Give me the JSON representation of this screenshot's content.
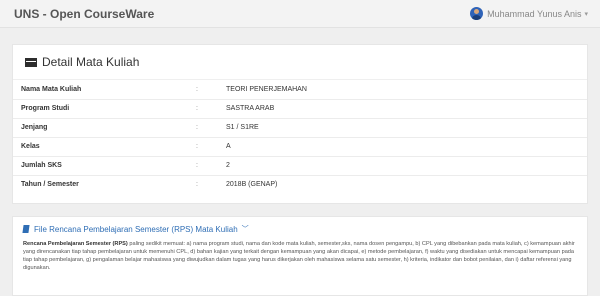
{
  "header": {
    "app_title": "UNS - Open CourseWare",
    "user_name": "Muhammad Yunus Anis"
  },
  "detail": {
    "title": "Detail Mata Kuliah",
    "separator": ":",
    "rows": [
      {
        "label": "Nama Mata Kuliah",
        "value": "TEORI PENERJEMAHAN"
      },
      {
        "label": "Program Studi",
        "value": "SASTRA ARAB"
      },
      {
        "label": "Jenjang",
        "value": "S1 / S1RE"
      },
      {
        "label": "Kelas",
        "value": "A"
      },
      {
        "label": "Jumlah SKS",
        "value": "2"
      },
      {
        "label": "Tahun / Semester",
        "value": "2018B (GENAP)"
      }
    ]
  },
  "rps": {
    "title": "File Rencana Pembelajaran Semester (RPS) Mata Kuliah",
    "bold_intro": "Rencana Pembelajaran Semester (RPS)",
    "description": "paling sedikit memuat: a) nama program studi, nama dan kode mata kuliah, semester,sks, nama dosen pengampu, b) CPL yang dibebankan pada mata kuliah, c) kemampuan akhir yang direncanakan tiap tahap pembelajaran untuk memenuhi CPL, d) bahan kajian yang terkait dengan kemampuan yang akan dicapai, e) metode pembelajaran, f) waktu yang disediakan untuk mencapai kemampuan pada tiap tahap pembelajaran, g) pengalaman belajar mahasiswa yang diwujudkan dalam tugas yang harus dikerjakan oleh mahasiswa selama satu semester, h) kriteria, indikator dan bobot penilaian, dan i) daftar referensi yang digunakan."
  }
}
